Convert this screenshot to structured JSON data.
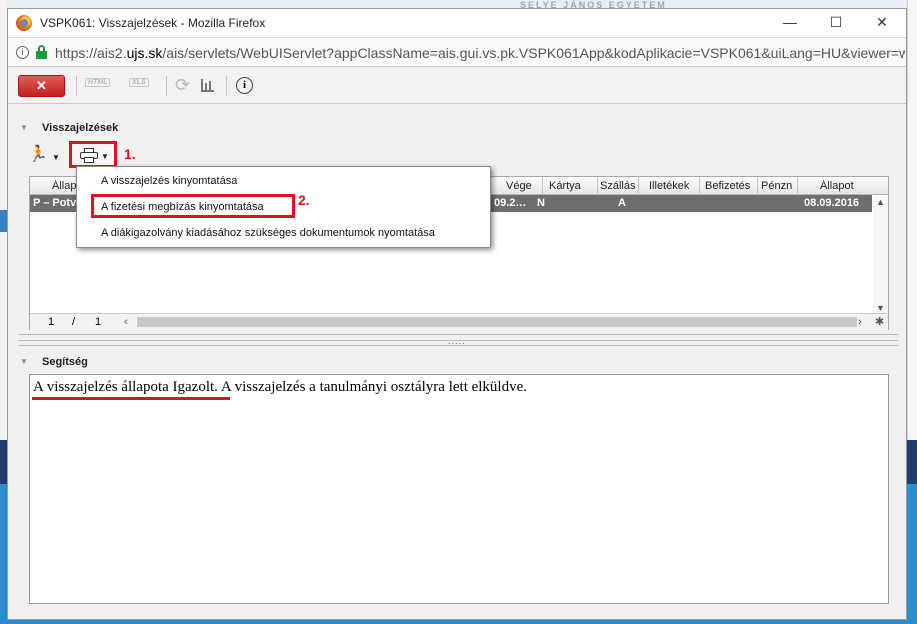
{
  "browser": {
    "window_title": "VSPK061: Visszajelzések - Mozilla Firefox",
    "url_prefix": "https://ais2.",
    "url_domain": "ujs.sk",
    "url_rest": "/ais/servlets/WebUIServlet?appClassName=ais.gui.vs.pk.VSPK061App&kodAplikacie=VSPK061&uiLang=HU&viewer=web",
    "background_banner": "SELYE JÁNOS EGYETEM"
  },
  "toolbar": {
    "close_label": "✕",
    "html_label": "HTML",
    "xls_label": "XLS"
  },
  "feedback_panel": {
    "title": "Visszajelzések",
    "annotation_1": "1.",
    "columns": [
      "Állapot",
      "Vége",
      "Kártya",
      "Szállás",
      "Illetékek",
      "Befizetés",
      "Pénzn",
      "Állapot"
    ],
    "row": {
      "status": "P – Potv",
      "end": "09.09.2…",
      "end_display": "09.2…",
      "card": "N",
      "accommodation": "A",
      "date": "08.09.2016"
    },
    "pager_current": "1",
    "pager_sep": "/",
    "pager_total": "1"
  },
  "print_menu": {
    "items": [
      "A visszajelzés kinyomtatása",
      "A fizetési megbízás kinyomtatása",
      "A diákigazolvány kiadásához szükséges dokumentumok nyomtatása"
    ],
    "annotation_2": "2."
  },
  "help_panel": {
    "title": "Segítség",
    "text_underlined": "A visszajelzés állapota Igazolt.",
    "text_rest": " A visszajelzés a tanulmányi osztályra lett elküldve."
  },
  "colors": {
    "annotation_red": "#e01020",
    "selected_row": "#6e6e6e",
    "close_button": "#c22020"
  }
}
